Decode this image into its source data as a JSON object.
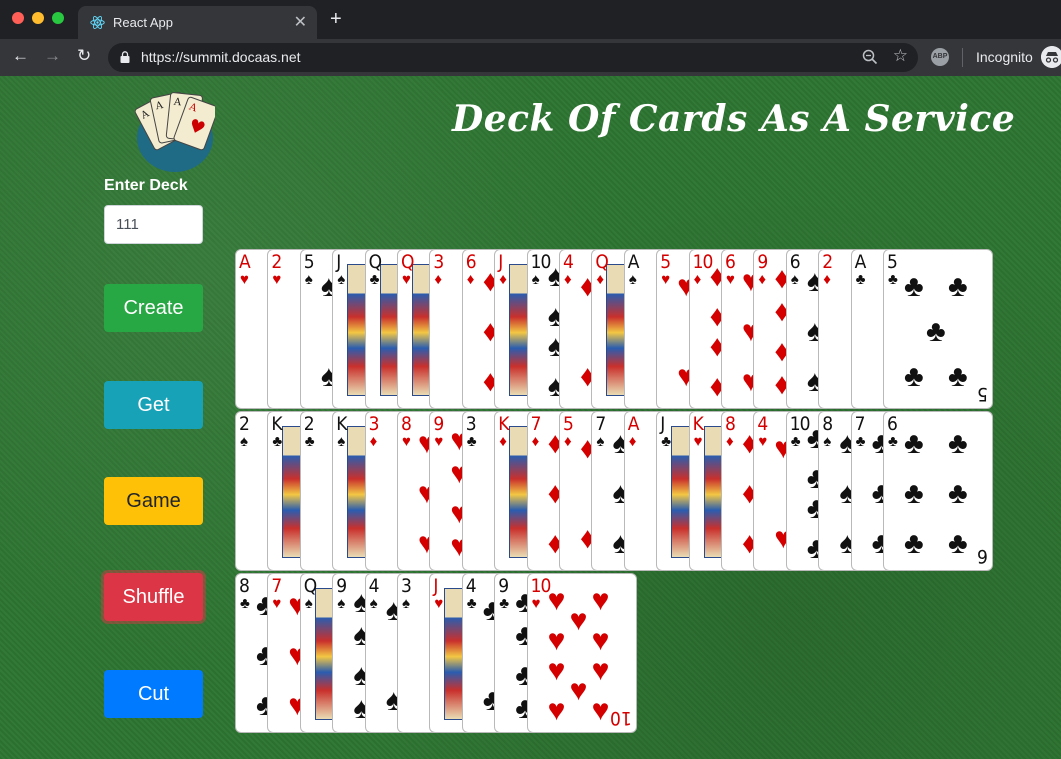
{
  "browser": {
    "tab_title": "React App",
    "url": "https://summit.docaas.net",
    "profile_label": "Incognito",
    "abp_label": "ABP"
  },
  "page": {
    "title": "Deck Of Cards As A Service",
    "deck_label": "Enter Deck",
    "deck_value": "111",
    "buttons": {
      "create": "Create",
      "get": "Get",
      "game": "Game",
      "shuffle": "Shuffle",
      "cut": "Cut"
    }
  },
  "colors": {
    "felt": "#2e7532",
    "create": "#28a745",
    "get": "#17a2b8",
    "game": "#ffc107",
    "shuffle": "#dc3545",
    "cut": "#007bff"
  },
  "cards": {
    "row1": [
      {
        "rank": "A",
        "suit": "♥",
        "color": "red"
      },
      {
        "rank": "2",
        "suit": "♥",
        "color": "red"
      },
      {
        "rank": "5",
        "suit": "♠",
        "color": "black"
      },
      {
        "rank": "J",
        "suit": "♠",
        "color": "black"
      },
      {
        "rank": "Q",
        "suit": "♣",
        "color": "black"
      },
      {
        "rank": "Q",
        "suit": "♥",
        "color": "red"
      },
      {
        "rank": "3",
        "suit": "♦",
        "color": "red"
      },
      {
        "rank": "6",
        "suit": "♦",
        "color": "red"
      },
      {
        "rank": "J",
        "suit": "♦",
        "color": "red"
      },
      {
        "rank": "10",
        "suit": "♠",
        "color": "black"
      },
      {
        "rank": "4",
        "suit": "♦",
        "color": "red"
      },
      {
        "rank": "Q",
        "suit": "♦",
        "color": "red"
      },
      {
        "rank": "A",
        "suit": "♠",
        "color": "black"
      },
      {
        "rank": "5",
        "suit": "♥",
        "color": "red"
      },
      {
        "rank": "10",
        "suit": "♦",
        "color": "red"
      },
      {
        "rank": "6",
        "suit": "♥",
        "color": "red"
      },
      {
        "rank": "9",
        "suit": "♦",
        "color": "red"
      },
      {
        "rank": "6",
        "suit": "♠",
        "color": "black"
      },
      {
        "rank": "2",
        "suit": "♦",
        "color": "red"
      },
      {
        "rank": "A",
        "suit": "♣",
        "color": "black"
      },
      {
        "rank": "5",
        "suit": "♣",
        "color": "black"
      }
    ],
    "row2": [
      {
        "rank": "2",
        "suit": "♠",
        "color": "black"
      },
      {
        "rank": "K",
        "suit": "♣",
        "color": "black"
      },
      {
        "rank": "2",
        "suit": "♣",
        "color": "black"
      },
      {
        "rank": "K",
        "suit": "♠",
        "color": "black"
      },
      {
        "rank": "3",
        "suit": "♦",
        "color": "red"
      },
      {
        "rank": "8",
        "suit": "♥",
        "color": "red"
      },
      {
        "rank": "9",
        "suit": "♥",
        "color": "red"
      },
      {
        "rank": "3",
        "suit": "♣",
        "color": "black"
      },
      {
        "rank": "K",
        "suit": "♦",
        "color": "red"
      },
      {
        "rank": "7",
        "suit": "♦",
        "color": "red"
      },
      {
        "rank": "5",
        "suit": "♦",
        "color": "red"
      },
      {
        "rank": "7",
        "suit": "♠",
        "color": "black"
      },
      {
        "rank": "A",
        "suit": "♦",
        "color": "red"
      },
      {
        "rank": "J",
        "suit": "♣",
        "color": "black"
      },
      {
        "rank": "K",
        "suit": "♥",
        "color": "red"
      },
      {
        "rank": "8",
        "suit": "♦",
        "color": "red"
      },
      {
        "rank": "4",
        "suit": "♥",
        "color": "red"
      },
      {
        "rank": "10",
        "suit": "♣",
        "color": "black"
      },
      {
        "rank": "8",
        "suit": "♠",
        "color": "black"
      },
      {
        "rank": "7",
        "suit": "♣",
        "color": "black"
      },
      {
        "rank": "6",
        "suit": "♣",
        "color": "black"
      }
    ],
    "row3": [
      {
        "rank": "8",
        "suit": "♣",
        "color": "black"
      },
      {
        "rank": "7",
        "suit": "♥",
        "color": "red"
      },
      {
        "rank": "Q",
        "suit": "♠",
        "color": "black"
      },
      {
        "rank": "9",
        "suit": "♠",
        "color": "black"
      },
      {
        "rank": "4",
        "suit": "♠",
        "color": "black"
      },
      {
        "rank": "3",
        "suit": "♠",
        "color": "black"
      },
      {
        "rank": "J",
        "suit": "♥",
        "color": "red"
      },
      {
        "rank": "4",
        "suit": "♣",
        "color": "black"
      },
      {
        "rank": "9",
        "suit": "♣",
        "color": "black"
      },
      {
        "rank": "10",
        "suit": "♥",
        "color": "red"
      }
    ]
  }
}
